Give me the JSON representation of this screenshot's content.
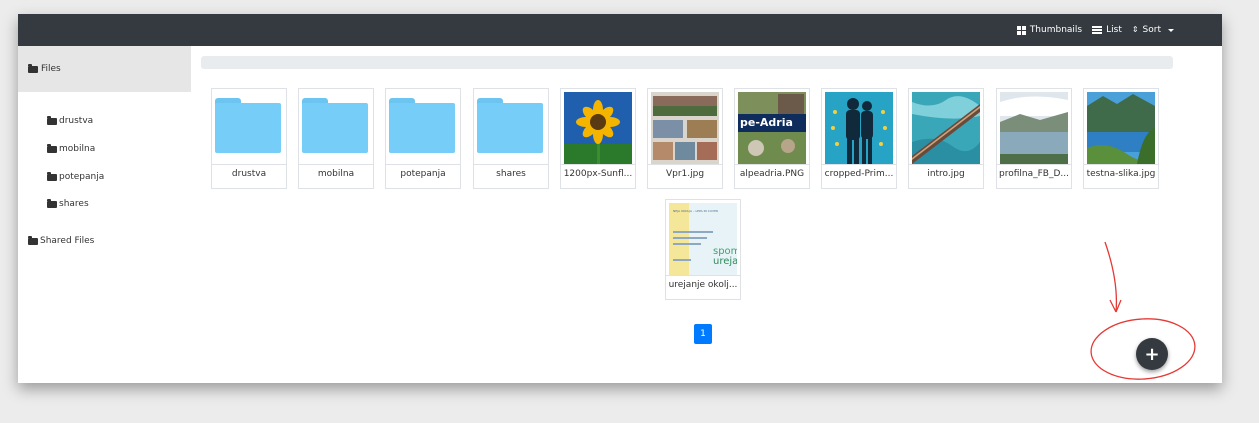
{
  "toolbar": {
    "thumbnails_label": "Thumbnails",
    "list_label": "List",
    "sort_label": "Sort"
  },
  "sidebar": {
    "root_label": "Files",
    "items": [
      {
        "label": "drustva"
      },
      {
        "label": "mobilna"
      },
      {
        "label": "potepanja"
      },
      {
        "label": "shares"
      }
    ],
    "shared_label": "Shared Files"
  },
  "files": [
    {
      "name": "drustva",
      "kind": "folder"
    },
    {
      "name": "mobilna",
      "kind": "folder"
    },
    {
      "name": "potepanja",
      "kind": "folder"
    },
    {
      "name": "shares",
      "kind": "folder"
    },
    {
      "name": "1200px-Sunfl...",
      "kind": "image"
    },
    {
      "name": "Vpr1.jpg",
      "kind": "image"
    },
    {
      "name": "alpeadria.PNG",
      "kind": "image"
    },
    {
      "name": "cropped-Prim...",
      "kind": "image"
    },
    {
      "name": "intro.jpg",
      "kind": "image"
    },
    {
      "name": "profilna_FB_D...",
      "kind": "image"
    },
    {
      "name": "testna-slika.jpg",
      "kind": "image"
    },
    {
      "name": "urejanje okolj...",
      "kind": "image"
    }
  ],
  "thumb_text": {
    "alpeadria": "pe-Adria",
    "urejanje_a": "spom",
    "urejanje_b": "urejan",
    "urejanje_top": "NEJA OKOLJA – LEPA IN CUVER"
  },
  "pagination": {
    "current": "1"
  },
  "fab": {
    "label": "+"
  },
  "colors": {
    "topbar": "#343a40",
    "folder": "#76cdf7",
    "accent": "#007bff",
    "annotation": "#e53935"
  }
}
